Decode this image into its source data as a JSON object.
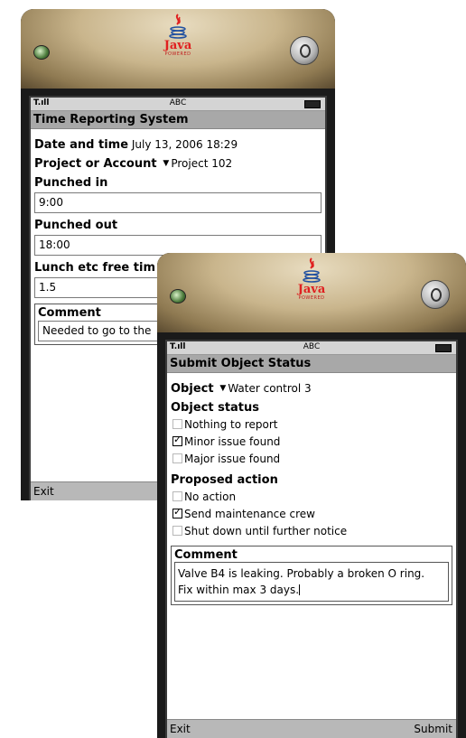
{
  "background_window": {
    "status": {
      "signal": "T.ıll",
      "input_mode": "ABC"
    },
    "title": "Time Reporting System",
    "date_label": "Date and time",
    "date_value": "July 13, 2006 18:29",
    "project_label": "Project or Account",
    "project_value": "Project 102",
    "punched_in_label": "Punched in",
    "punched_in_value": "9:00",
    "punched_out_label": "Punched out",
    "punched_out_value": "18:00",
    "lunch_label": "Lunch etc free tim",
    "lunch_value": "1.5",
    "comment_label": "Comment",
    "comment_value": "Needed to go to the",
    "softkey_left": "Exit"
  },
  "front_window": {
    "status": {
      "signal": "T.ıll",
      "input_mode": "ABC"
    },
    "title": "Submit Object Status",
    "object_label": "Object",
    "object_value": "Water control 3",
    "status_label": "Object status",
    "status_options": [
      {
        "label": "Nothing to report",
        "checked": false
      },
      {
        "label": "Minor issue found",
        "checked": true
      },
      {
        "label": "Major issue found",
        "checked": false
      }
    ],
    "action_label": "Proposed action",
    "action_options": [
      {
        "label": "No action",
        "checked": false
      },
      {
        "label": "Send maintenance crew",
        "checked": true
      },
      {
        "label": "Shut down until further notice",
        "checked": false
      }
    ],
    "comment_label": "Comment",
    "comment_line1": "Valve B4 is leaking. Probably a broken O ring.",
    "comment_line2": "Fix within max 3 days.",
    "softkey_left": "Exit",
    "softkey_right": "Submit"
  },
  "branding": {
    "logo_text": "Java",
    "logo_subtext": "POWERED",
    "logo_color": "#e02020"
  }
}
